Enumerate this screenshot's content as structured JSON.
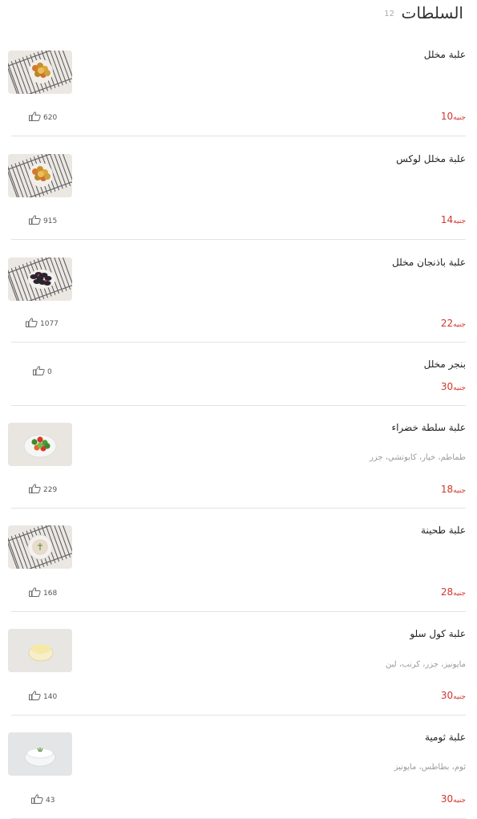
{
  "header": {
    "title": "السلطات",
    "count": "12"
  },
  "currency": "جنيه",
  "items": [
    {
      "name": "علبة مخلل",
      "desc": "",
      "price": "10",
      "likes": "620",
      "thumb": "pickles"
    },
    {
      "name": "علبة مخلل لوكس",
      "desc": "",
      "price": "14",
      "likes": "915",
      "thumb": "pickles"
    },
    {
      "name": "علبة باذنجان مخلل",
      "desc": "",
      "price": "22",
      "likes": "1077",
      "thumb": "eggplant"
    },
    {
      "name": "بنجر مخلل",
      "desc": "",
      "price": "30",
      "likes": "0",
      "thumb": ""
    },
    {
      "name": "علبة سلطة خضراء",
      "desc": "طماطم، خيار، كابوتشي، جزر",
      "price": "18",
      "likes": "229",
      "thumb": "green-salad"
    },
    {
      "name": "علبة طحينة",
      "desc": "",
      "price": "28",
      "likes": "168",
      "thumb": "tahini"
    },
    {
      "name": "علبة كول سلو",
      "desc": "مايونيز، جزر، كرنب، لبن",
      "price": "30",
      "likes": "140",
      "thumb": "coleslaw"
    },
    {
      "name": "علبة ثومية",
      "desc": "ثوم، بطاطس، مايونيز",
      "price": "30",
      "likes": "43",
      "thumb": "garlic-dip"
    }
  ]
}
